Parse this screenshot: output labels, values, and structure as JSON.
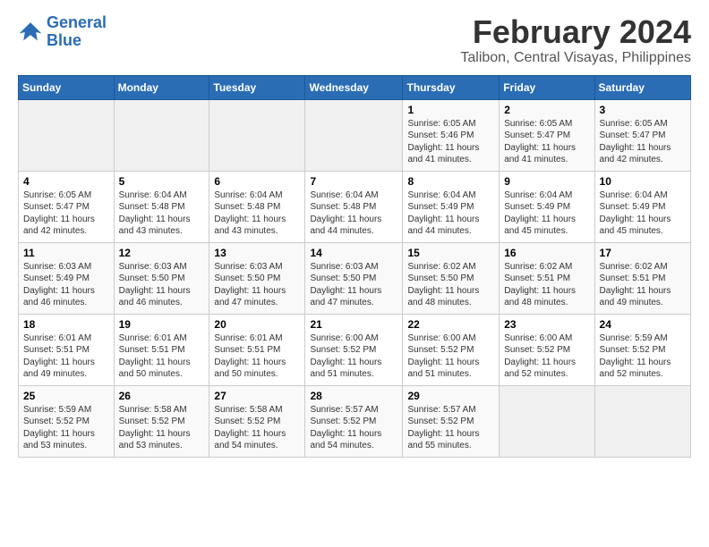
{
  "logo": {
    "line1": "General",
    "line2": "Blue"
  },
  "title": "February 2024",
  "location": "Talibon, Central Visayas, Philippines",
  "days_header": [
    "Sunday",
    "Monday",
    "Tuesday",
    "Wednesday",
    "Thursday",
    "Friday",
    "Saturday"
  ],
  "weeks": [
    [
      {
        "num": "",
        "info": ""
      },
      {
        "num": "",
        "info": ""
      },
      {
        "num": "",
        "info": ""
      },
      {
        "num": "",
        "info": ""
      },
      {
        "num": "1",
        "info": "Sunrise: 6:05 AM\nSunset: 5:46 PM\nDaylight: 11 hours and 41 minutes."
      },
      {
        "num": "2",
        "info": "Sunrise: 6:05 AM\nSunset: 5:47 PM\nDaylight: 11 hours and 41 minutes."
      },
      {
        "num": "3",
        "info": "Sunrise: 6:05 AM\nSunset: 5:47 PM\nDaylight: 11 hours and 42 minutes."
      }
    ],
    [
      {
        "num": "4",
        "info": "Sunrise: 6:05 AM\nSunset: 5:47 PM\nDaylight: 11 hours and 42 minutes."
      },
      {
        "num": "5",
        "info": "Sunrise: 6:04 AM\nSunset: 5:48 PM\nDaylight: 11 hours and 43 minutes."
      },
      {
        "num": "6",
        "info": "Sunrise: 6:04 AM\nSunset: 5:48 PM\nDaylight: 11 hours and 43 minutes."
      },
      {
        "num": "7",
        "info": "Sunrise: 6:04 AM\nSunset: 5:48 PM\nDaylight: 11 hours and 44 minutes."
      },
      {
        "num": "8",
        "info": "Sunrise: 6:04 AM\nSunset: 5:49 PM\nDaylight: 11 hours and 44 minutes."
      },
      {
        "num": "9",
        "info": "Sunrise: 6:04 AM\nSunset: 5:49 PM\nDaylight: 11 hours and 45 minutes."
      },
      {
        "num": "10",
        "info": "Sunrise: 6:04 AM\nSunset: 5:49 PM\nDaylight: 11 hours and 45 minutes."
      }
    ],
    [
      {
        "num": "11",
        "info": "Sunrise: 6:03 AM\nSunset: 5:49 PM\nDaylight: 11 hours and 46 minutes."
      },
      {
        "num": "12",
        "info": "Sunrise: 6:03 AM\nSunset: 5:50 PM\nDaylight: 11 hours and 46 minutes."
      },
      {
        "num": "13",
        "info": "Sunrise: 6:03 AM\nSunset: 5:50 PM\nDaylight: 11 hours and 47 minutes."
      },
      {
        "num": "14",
        "info": "Sunrise: 6:03 AM\nSunset: 5:50 PM\nDaylight: 11 hours and 47 minutes."
      },
      {
        "num": "15",
        "info": "Sunrise: 6:02 AM\nSunset: 5:50 PM\nDaylight: 11 hours and 48 minutes."
      },
      {
        "num": "16",
        "info": "Sunrise: 6:02 AM\nSunset: 5:51 PM\nDaylight: 11 hours and 48 minutes."
      },
      {
        "num": "17",
        "info": "Sunrise: 6:02 AM\nSunset: 5:51 PM\nDaylight: 11 hours and 49 minutes."
      }
    ],
    [
      {
        "num": "18",
        "info": "Sunrise: 6:01 AM\nSunset: 5:51 PM\nDaylight: 11 hours and 49 minutes."
      },
      {
        "num": "19",
        "info": "Sunrise: 6:01 AM\nSunset: 5:51 PM\nDaylight: 11 hours and 50 minutes."
      },
      {
        "num": "20",
        "info": "Sunrise: 6:01 AM\nSunset: 5:51 PM\nDaylight: 11 hours and 50 minutes."
      },
      {
        "num": "21",
        "info": "Sunrise: 6:00 AM\nSunset: 5:52 PM\nDaylight: 11 hours and 51 minutes."
      },
      {
        "num": "22",
        "info": "Sunrise: 6:00 AM\nSunset: 5:52 PM\nDaylight: 11 hours and 51 minutes."
      },
      {
        "num": "23",
        "info": "Sunrise: 6:00 AM\nSunset: 5:52 PM\nDaylight: 11 hours and 52 minutes."
      },
      {
        "num": "24",
        "info": "Sunrise: 5:59 AM\nSunset: 5:52 PM\nDaylight: 11 hours and 52 minutes."
      }
    ],
    [
      {
        "num": "25",
        "info": "Sunrise: 5:59 AM\nSunset: 5:52 PM\nDaylight: 11 hours and 53 minutes."
      },
      {
        "num": "26",
        "info": "Sunrise: 5:58 AM\nSunset: 5:52 PM\nDaylight: 11 hours and 53 minutes."
      },
      {
        "num": "27",
        "info": "Sunrise: 5:58 AM\nSunset: 5:52 PM\nDaylight: 11 hours and 54 minutes."
      },
      {
        "num": "28",
        "info": "Sunrise: 5:57 AM\nSunset: 5:52 PM\nDaylight: 11 hours and 54 minutes."
      },
      {
        "num": "29",
        "info": "Sunrise: 5:57 AM\nSunset: 5:52 PM\nDaylight: 11 hours and 55 minutes."
      },
      {
        "num": "",
        "info": ""
      },
      {
        "num": "",
        "info": ""
      }
    ]
  ]
}
